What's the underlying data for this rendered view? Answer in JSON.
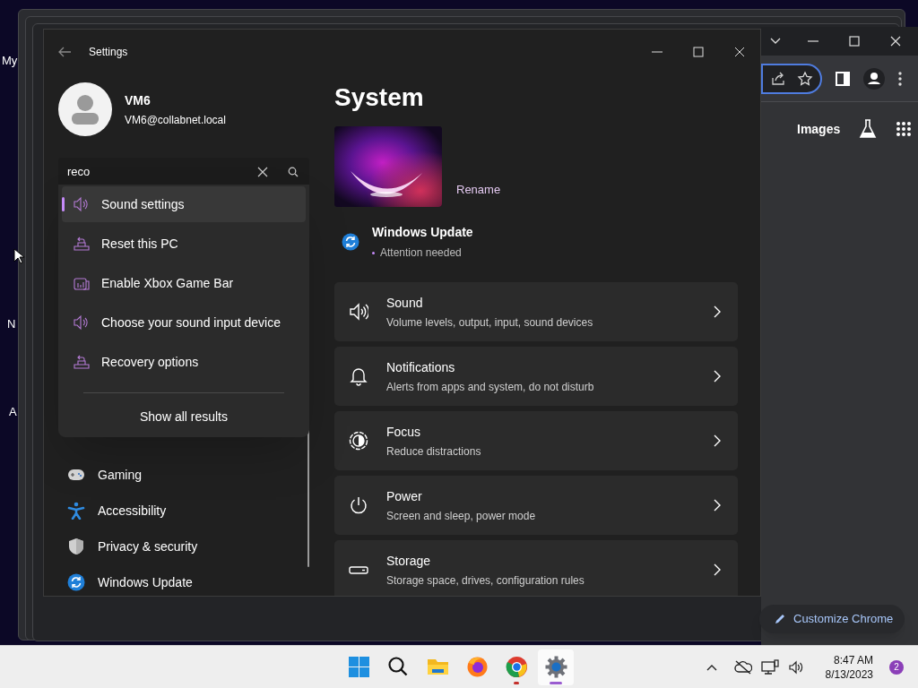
{
  "desktop_icons": [
    {
      "label": "My"
    },
    {
      "label": "N"
    },
    {
      "label": "A"
    }
  ],
  "chrome": {
    "nav_label": "Images",
    "customize_button": "Customize Chrome"
  },
  "settings": {
    "title": "Settings",
    "user": {
      "name": "VM6",
      "email": "VM6@collabnet.local"
    },
    "search": {
      "value": "reco"
    },
    "results": [
      {
        "label": "Sound settings",
        "kind": "sound",
        "selected": true
      },
      {
        "label": "Reset this PC",
        "kind": "reset",
        "selected": false
      },
      {
        "label": "Enable Xbox Game Bar",
        "kind": "xbox",
        "selected": false
      },
      {
        "label": "Choose your sound input device",
        "kind": "sound",
        "selected": false
      },
      {
        "label": "Recovery options",
        "kind": "reset",
        "selected": false
      }
    ],
    "show_all": "Show all results",
    "nav": [
      {
        "label": "Gaming",
        "kind": "gaming"
      },
      {
        "label": "Accessibility",
        "kind": "accessibility"
      },
      {
        "label": "Privacy & security",
        "kind": "privacy"
      },
      {
        "label": "Windows Update",
        "kind": "update"
      }
    ],
    "page_title": "System",
    "rename": "Rename",
    "update": {
      "title": "Windows Update",
      "status": "Attention needed"
    },
    "cards": [
      {
        "kind": "sound",
        "title": "Sound",
        "subtitle": "Volume levels, output, input, sound devices"
      },
      {
        "kind": "notifications",
        "title": "Notifications",
        "subtitle": "Alerts from apps and system, do not disturb"
      },
      {
        "kind": "focus",
        "title": "Focus",
        "subtitle": "Reduce distractions"
      },
      {
        "kind": "power",
        "title": "Power",
        "subtitle": "Screen and sleep, power mode"
      },
      {
        "kind": "storage",
        "title": "Storage",
        "subtitle": "Storage space, drives, configuration rules"
      }
    ]
  },
  "taskbar": {
    "apps": [
      {
        "kind": "start",
        "selected": false,
        "running": false
      },
      {
        "kind": "search",
        "selected": false,
        "running": false
      },
      {
        "kind": "explorer",
        "selected": false,
        "running": false
      },
      {
        "kind": "firefox",
        "selected": false,
        "running": false
      },
      {
        "kind": "chrome",
        "selected": false,
        "running": true
      },
      {
        "kind": "settings",
        "selected": true,
        "running": true
      }
    ],
    "time": "8:47 AM",
    "date": "8/13/2023",
    "notifications": "2"
  }
}
